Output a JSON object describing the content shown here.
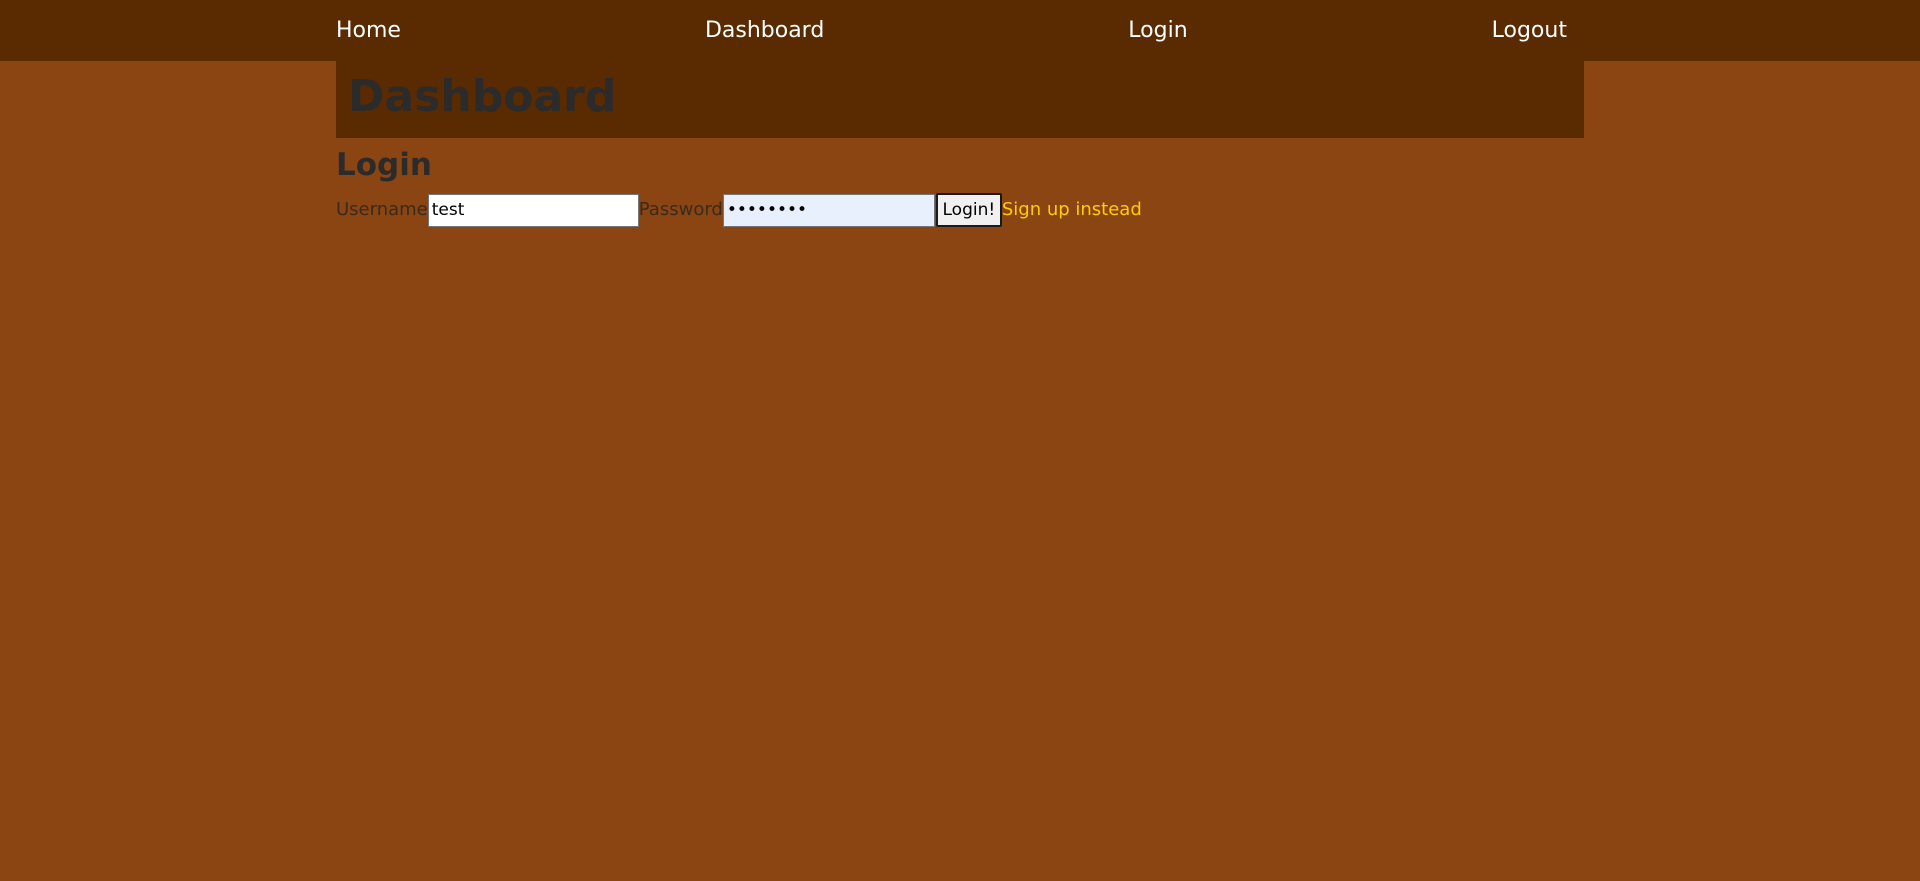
{
  "nav": {
    "items": [
      {
        "label": "Home"
      },
      {
        "label": "Dashboard"
      },
      {
        "label": "Login"
      },
      {
        "label": "Logout"
      }
    ]
  },
  "header": {
    "title": "Dashboard"
  },
  "login": {
    "title": "Login",
    "username_label": "Username",
    "username_value": "test",
    "password_label": "Password",
    "password_value": "••••••••",
    "submit_label": "Login!",
    "signup_link": "Sign up instead"
  },
  "colors": {
    "page_background": "#8b4513",
    "nav_background": "#5a2a00",
    "link_accent": "#ffcc00"
  }
}
